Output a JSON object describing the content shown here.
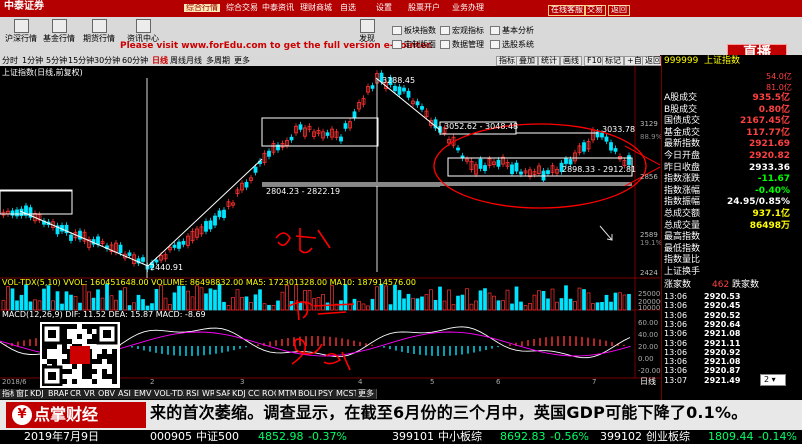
{
  "app": {
    "name": "中泰证券",
    "menu": [
      "综合行情",
      "综合交易",
      "中泰资讯",
      "理财商城",
      "自选",
      "设置",
      "股票开户",
      "业务办理"
    ],
    "links": [
      "在线客服",
      "交易",
      "返回"
    ]
  },
  "toolbar": {
    "buttons": [
      "沪深行情",
      "基金行情",
      "期货行情",
      "资讯中心",
      "发现"
    ],
    "watermark": "Please visit www.forEdu.com to get the full version e-Pointer.",
    "right_buttons": [
      "板块指数",
      "宏观指标",
      "基本分析",
      "定制版面",
      "数据管理",
      "选股系统"
    ],
    "zhibo": "直播"
  },
  "periods": [
    "分时",
    "1分钟",
    "5分钟",
    "15分钟",
    "30分钟",
    "60分钟",
    "日线",
    "周线",
    "月线",
    "多周期",
    "更多"
  ],
  "active_period": "日线",
  "chart_tools": [
    "指标",
    "叠加",
    "统计",
    "画线",
    "F10",
    "标记",
    "+自选",
    "返回"
  ],
  "chart": {
    "title": "上证指数(日线,前复权)",
    "high_label": "3288.45",
    "low_label": "2440.91",
    "box1": "3052.62 - 3048.48",
    "box2": "2898.33 - 2912.81",
    "box3": "2804.23 - 2822.19",
    "box_right_label": "3033.78",
    "y_ticks": [
      "3129",
      "88.9%",
      "2856",
      "2589",
      "19.1%",
      "2424"
    ],
    "handwriting": [
      "打架"
    ],
    "x_ticks": [
      "2018/6",
      "2",
      "3",
      "4",
      "5",
      "6",
      "7"
    ],
    "note_right": "日线"
  },
  "vol": {
    "text": "VOL-TDX(5,10)  VVOL: 160451648.00  VOLUME: 86498832.00  MA5: 172301328.00  MA10: 187914576.00",
    "ticks": [
      "25000",
      "2000000",
      "10000"
    ]
  },
  "macd": {
    "text": "MACD(12,26,9)  DIF: 11.52  DEA: 15.87  MACD: -8.69",
    "ticks": [
      "60.00",
      "40.00",
      "20.00",
      "0.00",
      "-20.00"
    ]
  },
  "indicator_tabs": [
    "指标",
    "窗口",
    "KDJ",
    "BRAR",
    "CR",
    "VR",
    "OBV",
    "ASI",
    "EMV",
    "VOL-TDX",
    "RSI",
    "WR",
    "SAR",
    "KDJ",
    "CCI",
    "ROC",
    "MTM",
    "BOLL",
    "PSY",
    "MCST",
    "更多"
  ],
  "right_panel": {
    "code": "999999",
    "name": "上证指数",
    "top_vals": [
      "54.0亿",
      "81.0亿"
    ],
    "rows": [
      {
        "label": "A股成交",
        "value": "935.5亿",
        "color": "#ff4040"
      },
      {
        "label": "B股成交",
        "value": "0.80亿",
        "color": "#ff4040"
      },
      {
        "label": "国债成交",
        "value": "2167.45亿",
        "color": "#ff4040"
      },
      {
        "label": "基金成交",
        "value": "117.77亿",
        "color": "#ff4040"
      },
      {
        "label": "最新指数",
        "value": "2921.69",
        "color": "#ff4040"
      },
      {
        "label": "今日开盘",
        "value": "2920.82",
        "color": "#ff4040"
      },
      {
        "label": "昨日收盘",
        "value": "2933.36",
        "color": "#fff"
      },
      {
        "label": "指数涨跌",
        "value": "-11.67",
        "color": "#00ff00"
      },
      {
        "label": "指数涨幅",
        "value": "-0.40%",
        "color": "#00ff00"
      },
      {
        "label": "指数振幅",
        "value": "24.95/0.85%",
        "color": "#fff"
      },
      {
        "label": "总成交额",
        "value": "937.1亿",
        "color": "#ffff00"
      },
      {
        "label": "总成交量",
        "value": "86498万",
        "color": "#ffff00"
      },
      {
        "label": "最高指数",
        "value": "",
        "color": "#fff"
      },
      {
        "label": "最低指数",
        "value": "",
        "color": "#fff"
      },
      {
        "label": "指数量比",
        "value": "",
        "color": "#fff"
      },
      {
        "label": "上证换手",
        "value": "",
        "color": "#fff"
      }
    ],
    "updown": {
      "up_label": "涨家数",
      "up": "462",
      "down_label": "跌家数"
    },
    "trades": [
      {
        "time": "13:06",
        "price": "2920.53"
      },
      {
        "time": "13:06",
        "price": "2920.45"
      },
      {
        "time": "13:06",
        "price": "2920.52"
      },
      {
        "time": "13:06",
        "price": "2920.64"
      },
      {
        "time": "13:06",
        "price": "2921.08"
      },
      {
        "time": "13:06",
        "price": "2921.11"
      },
      {
        "time": "13:06",
        "price": "2920.92"
      },
      {
        "time": "13:06",
        "price": "2921.08"
      },
      {
        "time": "13:06",
        "price": "2920.87"
      },
      {
        "time": "13:07",
        "price": "2921.49"
      }
    ],
    "level_select": "2"
  },
  "ticker": {
    "logo": "点掌财经",
    "text": "来的首次萎缩。调查显示，在截至6月份的三个月中，英国GDP可能下降了0.1%。"
  },
  "bottom": {
    "date": "2019年7月9日",
    "quotes": [
      {
        "code": "000905",
        "name": "中证500",
        "price": "4852.98",
        "change": "-0.37%"
      },
      {
        "code": "399101",
        "name": "中小板综",
        "price": "8692.83",
        "change": "-0.56%"
      },
      {
        "code": "399102",
        "name": "创业板综",
        "price": "1809.44",
        "change": "-0.14%"
      }
    ]
  },
  "colors": {
    "up": "#ff3333",
    "down": "#00e5ff",
    "brand": "#b40000",
    "annotation": "#ff0000"
  }
}
